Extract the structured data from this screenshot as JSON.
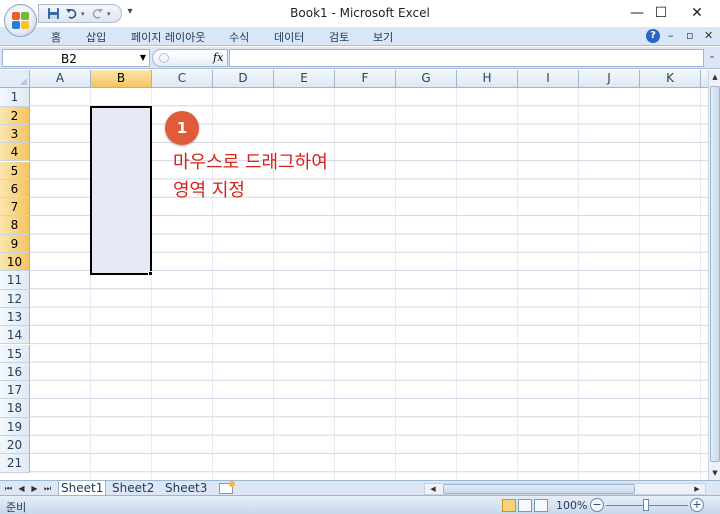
{
  "window": {
    "title": "Book1 - Microsoft Excel",
    "minimize_glyph": "—",
    "maximize_glyph": "☐",
    "close_glyph": "✕"
  },
  "quick_access": {
    "save_icon": "save-icon",
    "undo_icon": "undo-icon",
    "redo_icon": "redo-icon",
    "more_icon": "customize-qat-icon"
  },
  "ribbon": {
    "tabs": [
      "홈",
      "삽입",
      "페이지 레이아웃",
      "수식",
      "데이터",
      "검토",
      "보기"
    ],
    "help_glyph": "?",
    "minimize_glyph": "–",
    "restore_glyph": "▫",
    "close_glyph": "✕"
  },
  "formula_bar": {
    "name_box_value": "B2",
    "fx_label": "fx",
    "formula_value": ""
  },
  "grid": {
    "columns": [
      "A",
      "B",
      "C",
      "D",
      "E",
      "F",
      "G",
      "H",
      "I",
      "J",
      "K"
    ],
    "rows": [
      "1",
      "2",
      "3",
      "4",
      "5",
      "6",
      "7",
      "8",
      "9",
      "10",
      "11",
      "12",
      "13",
      "14",
      "15",
      "16",
      "17",
      "18",
      "19",
      "20",
      "21"
    ],
    "selected_column": "B",
    "selected_rows": [
      "2",
      "3",
      "4",
      "5",
      "6",
      "7",
      "8",
      "9",
      "10"
    ],
    "selection_range": "B2:B10"
  },
  "annotation": {
    "badge_number": "1",
    "line1": "마우스로 드래그하여",
    "line2": "영역 지정",
    "color": "#d8221c"
  },
  "sheets": {
    "tabs": [
      "Sheet1",
      "Sheet2",
      "Sheet3"
    ],
    "active": "Sheet1"
  },
  "status": {
    "ready": "준비",
    "zoom": "100%",
    "zoom_minus": "−",
    "zoom_plus": "+"
  },
  "colors": {
    "ribbon_bg": "#d9e6f6",
    "header_selected": "#f5c462",
    "selection_fill": "#e6eaf5",
    "badge": "#e05b3a"
  }
}
